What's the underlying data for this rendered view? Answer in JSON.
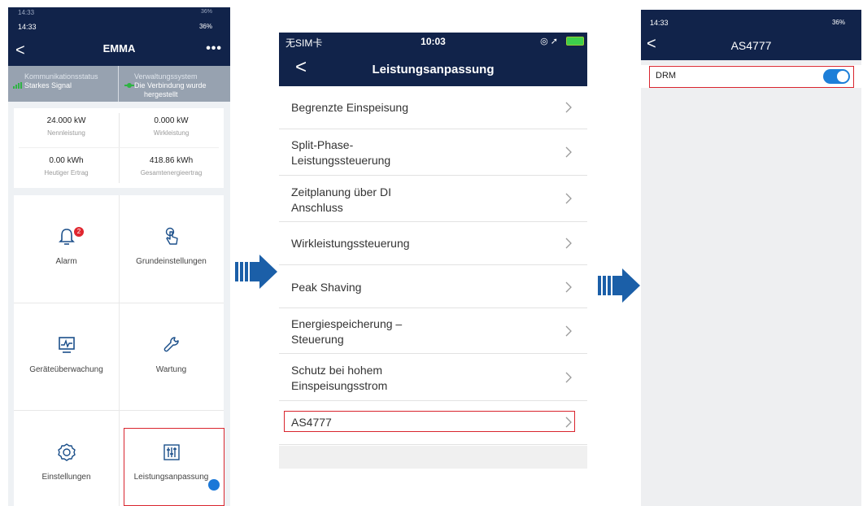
{
  "screen1": {
    "ghost_time": "14:33",
    "ghost_status": "36%",
    "time": "14:33",
    "status": "36%",
    "back": "<",
    "title": "EMMA",
    "more": "•••",
    "comm_status": {
      "label": "Kommunikationsstatus",
      "value": "Starkes Signal"
    },
    "mgmt_system": {
      "label": "Verwaltungssystem",
      "value_line1": "Die Verbindung wurde",
      "value_line2": "hergestellt"
    },
    "metrics": [
      {
        "value": "24.000 kW",
        "label": "Nennleistung"
      },
      {
        "value": "0.000 kW",
        "label": "Wirkleistung"
      },
      {
        "value": "0.00 kWh",
        "label": "Heutiger Ertrag"
      },
      {
        "value": "418.86 kWh",
        "label": "Gesamtenergieertrag"
      }
    ],
    "tiles": {
      "alarm": "Alarm",
      "alarm_badge": "2",
      "basic_settings": "Grundeinstellungen",
      "device_monitoring": "Geräteüberwachung",
      "maintenance": "Wartung",
      "settings": "Einstellungen",
      "power_adjustment": "Leistungsanpassung"
    }
  },
  "screen2": {
    "carrier": "无SIM卡",
    "clock": "10:03",
    "back": "<",
    "title": "Leistungsanpassung",
    "items": [
      {
        "line1": "Begrenzte Einspeisung",
        "line2": ""
      },
      {
        "line1": "Split-Phase-",
        "line2": "Leistungssteuerung"
      },
      {
        "line1": "Zeitplanung über DI",
        "line2": "Anschluss"
      },
      {
        "line1": "Wirkleistungssteuerung",
        "line2": ""
      },
      {
        "line1": "Peak Shaving",
        "line2": ""
      },
      {
        "line1": "Energiespeicherung –",
        "line2": "Steuerung"
      },
      {
        "line1": "Schutz bei hohem",
        "line2": "Einspeisungsstrom"
      },
      {
        "line1": "AS4777",
        "line2": ""
      }
    ]
  },
  "screen3": {
    "time": "14:33",
    "status": "36%",
    "back": "<",
    "title": "AS4777",
    "drm_label": "DRM",
    "drm_enabled": true
  },
  "colors": {
    "header": "#11234a",
    "accent": "#1c7ed8",
    "highlight": "#d9252e",
    "signal_green": "#2fb344"
  }
}
